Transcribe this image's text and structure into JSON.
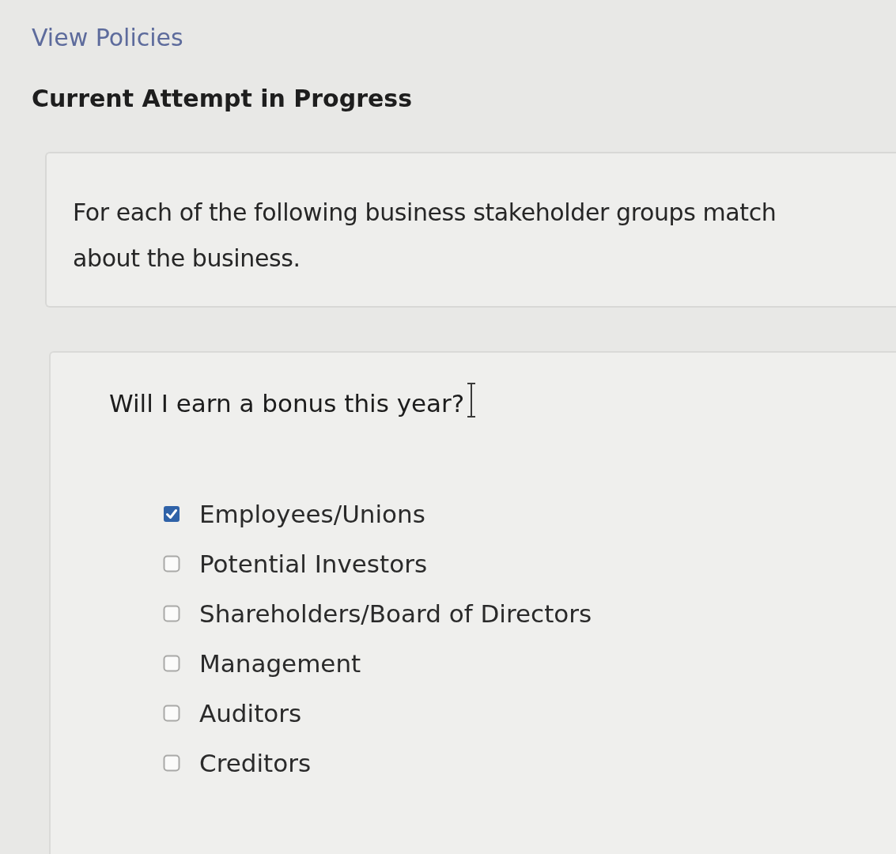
{
  "header": {
    "link": "View Policies",
    "title": "Current Attempt in Progress"
  },
  "instructions": {
    "lines": [
      "For each of the following business stakeholder groups match",
      "about the business."
    ]
  },
  "question": {
    "prompt": "Will I earn a bonus this year?",
    "options": [
      {
        "label": "Employees/Unions",
        "checked": true
      },
      {
        "label": "Potential Investors",
        "checked": false
      },
      {
        "label": "Shareholders/Board of Directors",
        "checked": false
      },
      {
        "label": "Management",
        "checked": false
      },
      {
        "label": "Auditors",
        "checked": false
      },
      {
        "label": "Creditors",
        "checked": false
      }
    ]
  }
}
